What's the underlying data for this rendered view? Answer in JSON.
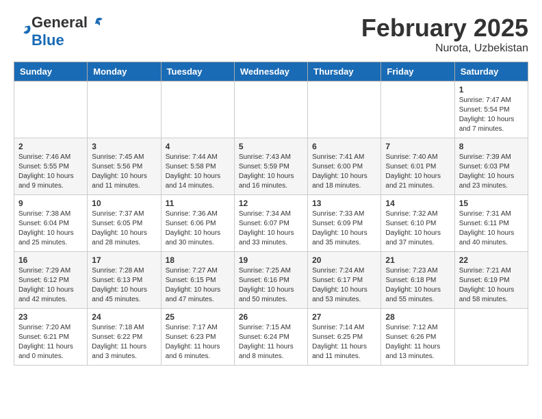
{
  "header": {
    "logo_line1": "General",
    "logo_line2": "Blue",
    "month_title": "February 2025",
    "location": "Nurota, Uzbekistan"
  },
  "days_of_week": [
    "Sunday",
    "Monday",
    "Tuesday",
    "Wednesday",
    "Thursday",
    "Friday",
    "Saturday"
  ],
  "weeks": [
    [
      {
        "day": "",
        "info": ""
      },
      {
        "day": "",
        "info": ""
      },
      {
        "day": "",
        "info": ""
      },
      {
        "day": "",
        "info": ""
      },
      {
        "day": "",
        "info": ""
      },
      {
        "day": "",
        "info": ""
      },
      {
        "day": "1",
        "info": "Sunrise: 7:47 AM\nSunset: 5:54 PM\nDaylight: 10 hours and 7 minutes."
      }
    ],
    [
      {
        "day": "2",
        "info": "Sunrise: 7:46 AM\nSunset: 5:55 PM\nDaylight: 10 hours and 9 minutes."
      },
      {
        "day": "3",
        "info": "Sunrise: 7:45 AM\nSunset: 5:56 PM\nDaylight: 10 hours and 11 minutes."
      },
      {
        "day": "4",
        "info": "Sunrise: 7:44 AM\nSunset: 5:58 PM\nDaylight: 10 hours and 14 minutes."
      },
      {
        "day": "5",
        "info": "Sunrise: 7:43 AM\nSunset: 5:59 PM\nDaylight: 10 hours and 16 minutes."
      },
      {
        "day": "6",
        "info": "Sunrise: 7:41 AM\nSunset: 6:00 PM\nDaylight: 10 hours and 18 minutes."
      },
      {
        "day": "7",
        "info": "Sunrise: 7:40 AM\nSunset: 6:01 PM\nDaylight: 10 hours and 21 minutes."
      },
      {
        "day": "8",
        "info": "Sunrise: 7:39 AM\nSunset: 6:03 PM\nDaylight: 10 hours and 23 minutes."
      }
    ],
    [
      {
        "day": "9",
        "info": "Sunrise: 7:38 AM\nSunset: 6:04 PM\nDaylight: 10 hours and 25 minutes."
      },
      {
        "day": "10",
        "info": "Sunrise: 7:37 AM\nSunset: 6:05 PM\nDaylight: 10 hours and 28 minutes."
      },
      {
        "day": "11",
        "info": "Sunrise: 7:36 AM\nSunset: 6:06 PM\nDaylight: 10 hours and 30 minutes."
      },
      {
        "day": "12",
        "info": "Sunrise: 7:34 AM\nSunset: 6:07 PM\nDaylight: 10 hours and 33 minutes."
      },
      {
        "day": "13",
        "info": "Sunrise: 7:33 AM\nSunset: 6:09 PM\nDaylight: 10 hours and 35 minutes."
      },
      {
        "day": "14",
        "info": "Sunrise: 7:32 AM\nSunset: 6:10 PM\nDaylight: 10 hours and 37 minutes."
      },
      {
        "day": "15",
        "info": "Sunrise: 7:31 AM\nSunset: 6:11 PM\nDaylight: 10 hours and 40 minutes."
      }
    ],
    [
      {
        "day": "16",
        "info": "Sunrise: 7:29 AM\nSunset: 6:12 PM\nDaylight: 10 hours and 42 minutes."
      },
      {
        "day": "17",
        "info": "Sunrise: 7:28 AM\nSunset: 6:13 PM\nDaylight: 10 hours and 45 minutes."
      },
      {
        "day": "18",
        "info": "Sunrise: 7:27 AM\nSunset: 6:15 PM\nDaylight: 10 hours and 47 minutes."
      },
      {
        "day": "19",
        "info": "Sunrise: 7:25 AM\nSunset: 6:16 PM\nDaylight: 10 hours and 50 minutes."
      },
      {
        "day": "20",
        "info": "Sunrise: 7:24 AM\nSunset: 6:17 PM\nDaylight: 10 hours and 53 minutes."
      },
      {
        "day": "21",
        "info": "Sunrise: 7:23 AM\nSunset: 6:18 PM\nDaylight: 10 hours and 55 minutes."
      },
      {
        "day": "22",
        "info": "Sunrise: 7:21 AM\nSunset: 6:19 PM\nDaylight: 10 hours and 58 minutes."
      }
    ],
    [
      {
        "day": "23",
        "info": "Sunrise: 7:20 AM\nSunset: 6:21 PM\nDaylight: 11 hours and 0 minutes."
      },
      {
        "day": "24",
        "info": "Sunrise: 7:18 AM\nSunset: 6:22 PM\nDaylight: 11 hours and 3 minutes."
      },
      {
        "day": "25",
        "info": "Sunrise: 7:17 AM\nSunset: 6:23 PM\nDaylight: 11 hours and 6 minutes."
      },
      {
        "day": "26",
        "info": "Sunrise: 7:15 AM\nSunset: 6:24 PM\nDaylight: 11 hours and 8 minutes."
      },
      {
        "day": "27",
        "info": "Sunrise: 7:14 AM\nSunset: 6:25 PM\nDaylight: 11 hours and 11 minutes."
      },
      {
        "day": "28",
        "info": "Sunrise: 7:12 AM\nSunset: 6:26 PM\nDaylight: 11 hours and 13 minutes."
      },
      {
        "day": "",
        "info": ""
      }
    ]
  ]
}
